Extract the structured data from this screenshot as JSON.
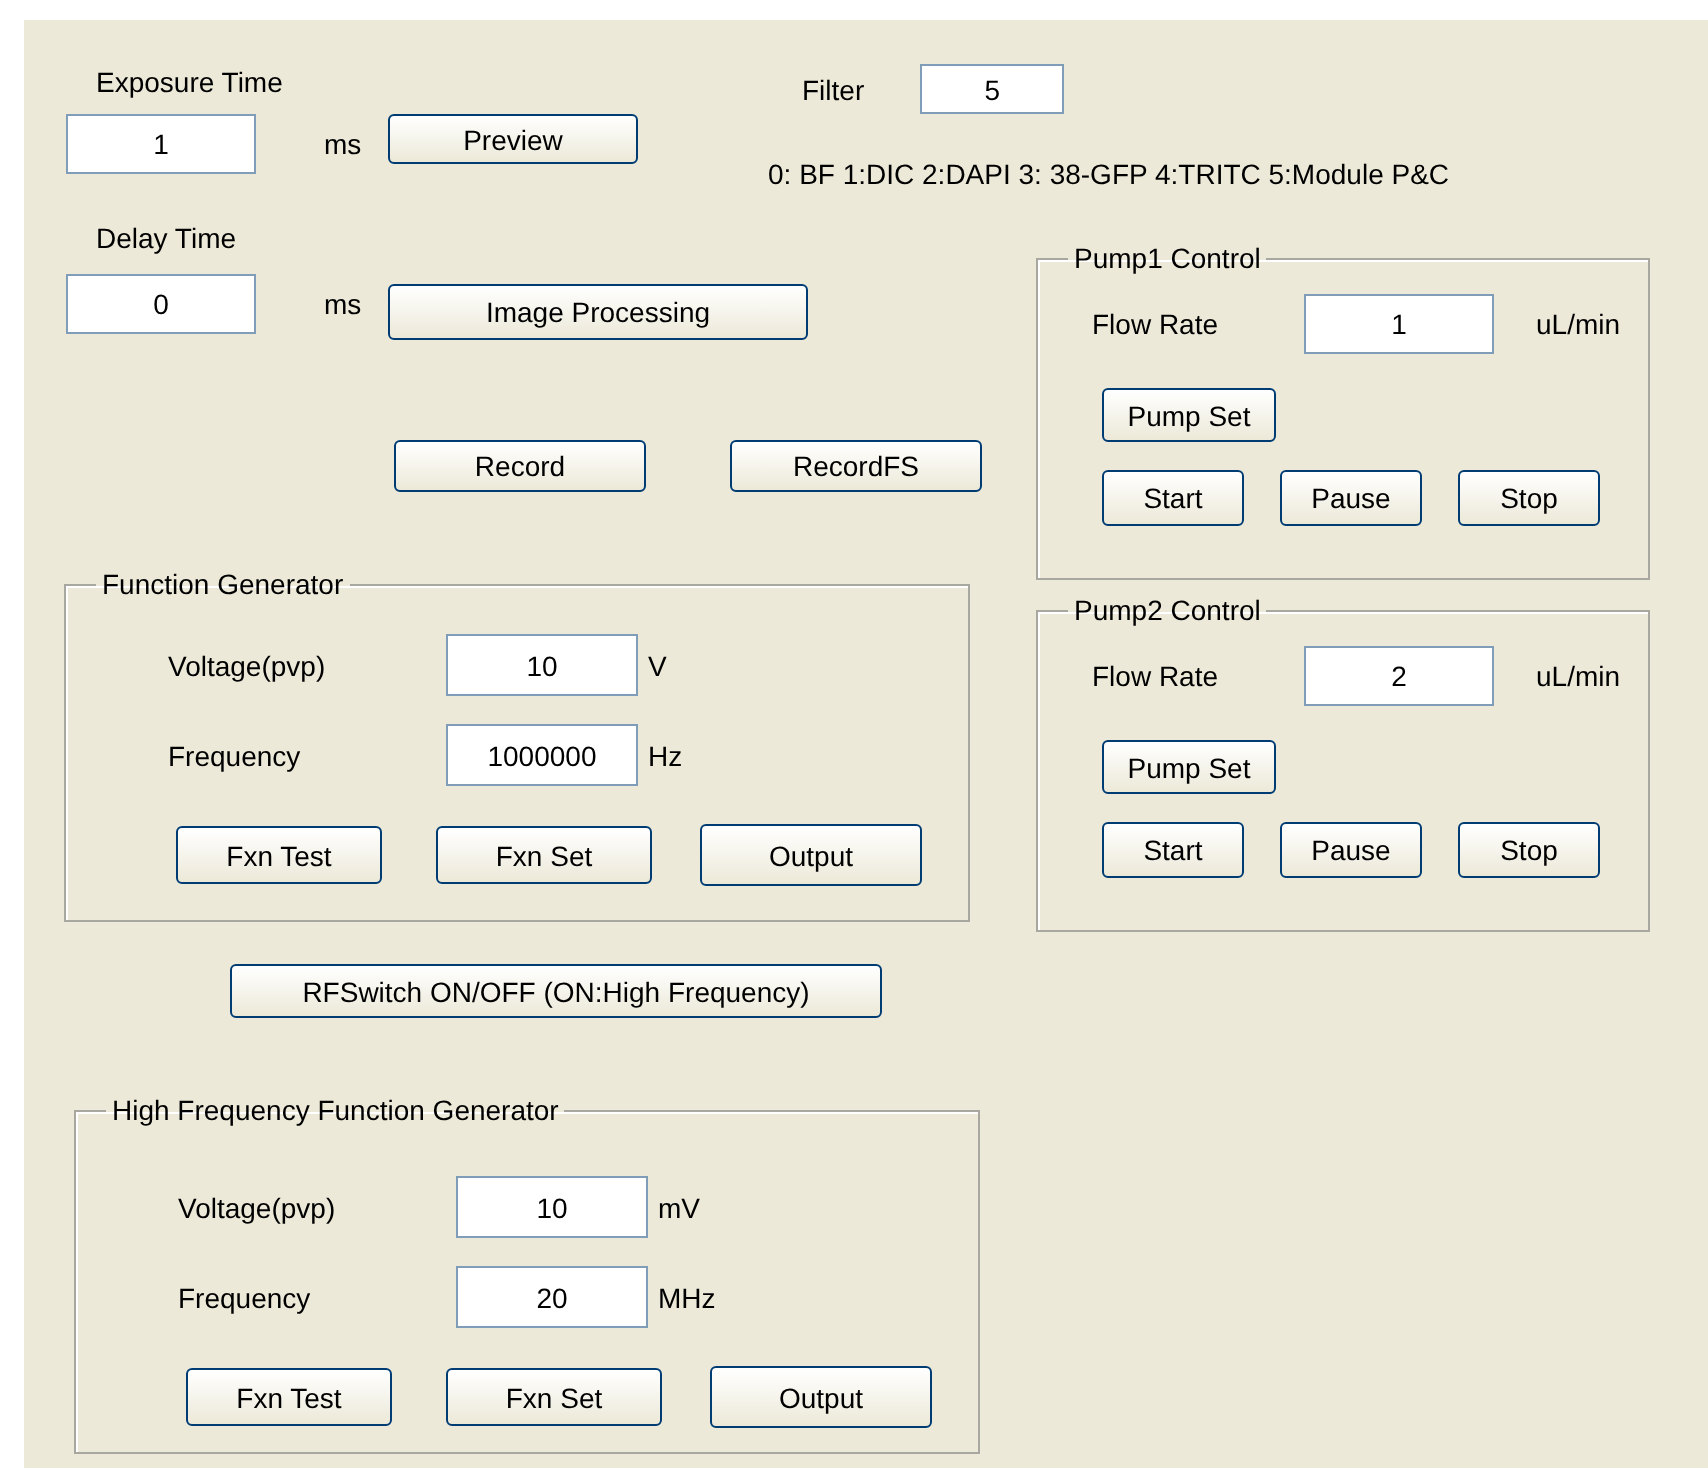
{
  "exposure": {
    "label": "Exposure Time",
    "value": "1",
    "unit": "ms"
  },
  "preview_button": "Preview",
  "filter": {
    "label": "Filter",
    "value": "5",
    "legend": "0: BF 1:DIC 2:DAPI 3: 38-GFP 4:TRITC 5:Module P&C"
  },
  "delay": {
    "label": "Delay Time",
    "value": "0",
    "unit": "ms"
  },
  "image_processing_button": "Image Processing",
  "record_buttons": [
    "Record",
    "RecordFS"
  ],
  "function_generator": {
    "title": "Function Generator",
    "rows": [
      {
        "label": "Voltage(pvp)",
        "value": "10",
        "unit": "V"
      },
      {
        "label": "Frequency",
        "value": "1000000",
        "unit": "Hz"
      }
    ],
    "buttons": [
      "Fxn Test",
      "Fxn Set",
      "Output"
    ]
  },
  "rf_switch_button": "RFSwitch ON/OFF (ON:High Frequency)",
  "hf_function_generator": {
    "title": "High Frequency Function Generator",
    "rows": [
      {
        "label": "Voltage(pvp)",
        "value": "10",
        "unit": "mV"
      },
      {
        "label": "Frequency",
        "value": "20",
        "unit": "MHz"
      }
    ],
    "buttons": [
      "Fxn Test",
      "Fxn Set",
      "Output"
    ]
  },
  "pumps": [
    {
      "title": "Pump1 Control",
      "flow_label": "Flow Rate",
      "value": "1",
      "unit": "uL/min",
      "set_button": "Pump Set",
      "buttons": [
        "Start",
        "Pause",
        "Stop"
      ]
    },
    {
      "title": "Pump2 Control",
      "flow_label": "Flow Rate",
      "value": "2",
      "unit": "uL/min",
      "set_button": "Pump Set",
      "buttons": [
        "Start",
        "Pause",
        "Stop"
      ]
    }
  ]
}
